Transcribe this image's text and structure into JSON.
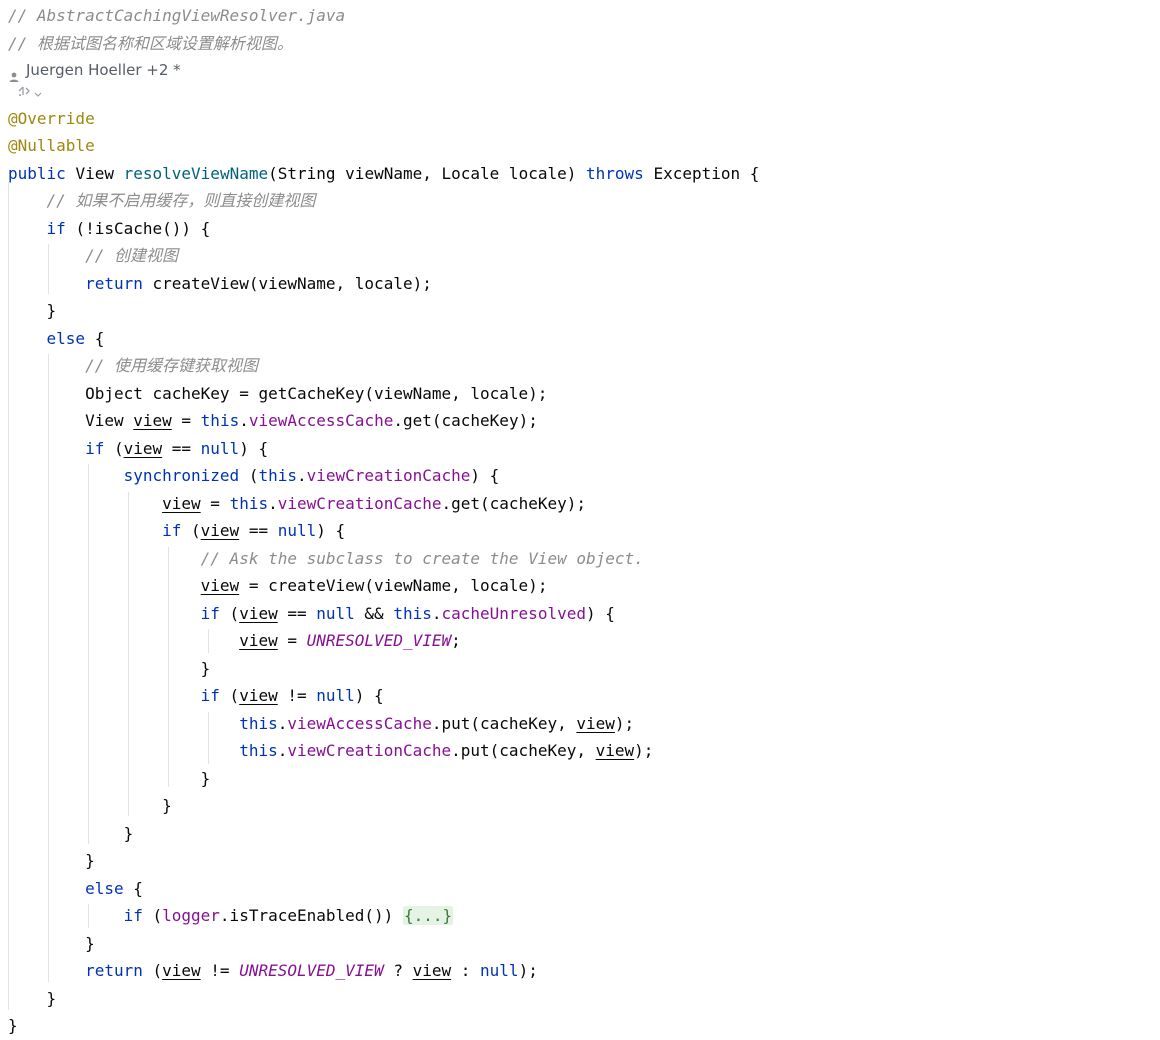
{
  "editor": {
    "header_comment_file": "// AbstractCachingViewResolver.java",
    "header_comment_desc": "// 根据试图名称和区域设置解析视图。",
    "author": "Juergen Hoeller +2 *",
    "annotation_override": "@Override",
    "annotation_nullable": "@Nullable",
    "tokens": {
      "public": "public",
      "view_type": "View",
      "method_name": "resolveViewName",
      "params": "(String viewName, Locale locale)",
      "throws": "throws",
      "exception": "Exception {",
      "comment_no_cache": "// 如果不启用缓存，则直接创建视图",
      "if": "if",
      "not_cache": "(!isCache()) {",
      "comment_create": "// 创建视图",
      "return": "return",
      "create_view_call": "createView(viewName, locale);",
      "close": "}",
      "else": "else",
      "open_brace": "{",
      "comment_use_cache": "// 使用缓存键获取视图",
      "cache_key_line": "Object cacheKey = getCacheKey(viewName, locale);",
      "view": "view",
      "assign": " = ",
      "this": "this",
      "dot": ".",
      "view_access_cache": "viewAccessCache",
      "view_creation_cache": "viewCreationCache",
      "get_cache_key": ".get(cacheKey);",
      "paren_open": " (",
      "eq_null": " == ",
      "neq_null": " != ",
      "null": "null",
      "paren_close_brace": ") {",
      "synchronized": "synchronized",
      "comment_ask": "// Ask the subclass to create the View object.",
      "and": " && ",
      "cache_unresolved": "cacheUnresolved",
      "unresolved_view": "UNRESOLVED_VIEW",
      "semicolon": ";",
      "put_open": ".put(cacheKey, ",
      "put_close": ");",
      "logger": "logger",
      "is_trace": ".isTraceEnabled()) ",
      "folded": "{...}",
      "ternary_q": " ? ",
      "ternary_colon": " : ",
      "return_close": ");",
      "if_paren": "(",
      "space": " "
    }
  }
}
